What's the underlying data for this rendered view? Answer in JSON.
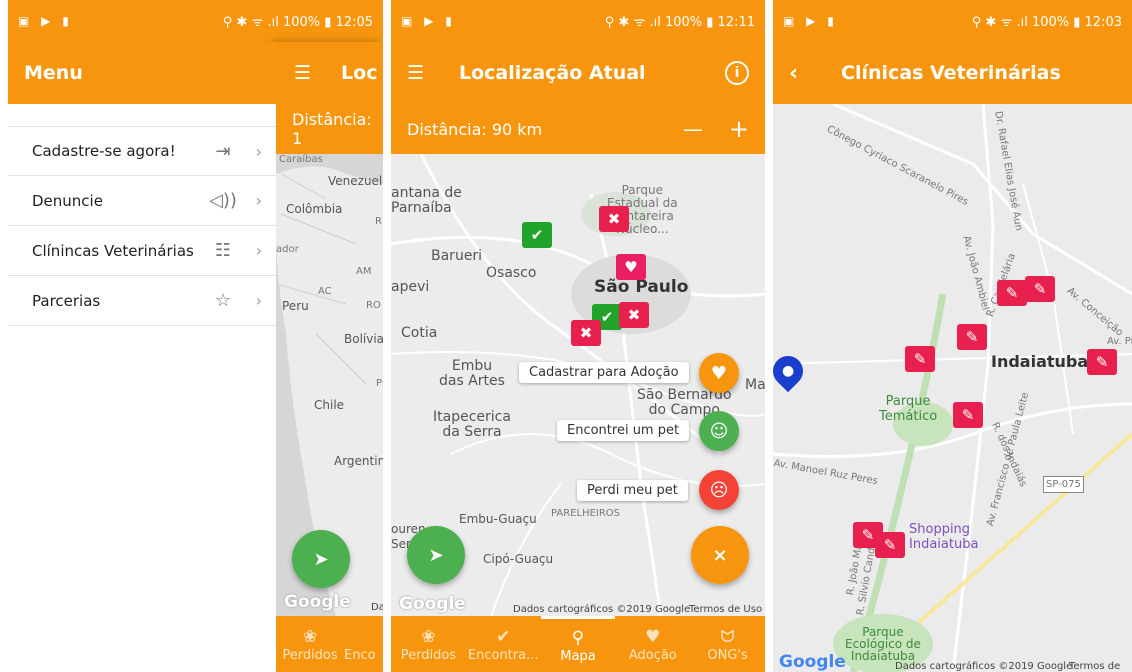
{
  "colors": {
    "primary": "#f7960e",
    "green": "#4caf50",
    "red": "#f44336",
    "pink": "#e91e63",
    "blue": "#1a3fcf"
  },
  "status": {
    "left_icons": "▣ ▶ ▮",
    "right_1": "⚲ ✱ ᯤ .ıl 100% ▮ 12:05",
    "right_2": "⚲ ✱ ᯤ .ıl 100% ▮ 12:11",
    "right_3": "⚲ ✱ ᯤ .ıl 100% ▮ 12:03"
  },
  "screen1": {
    "menu": {
      "title": "Menu",
      "items": [
        {
          "label": "Cadastre-se agora!",
          "icon": "login-icon"
        },
        {
          "label": "Denuncie",
          "icon": "speaker-icon"
        },
        {
          "label": "Clínincas Veterinárias",
          "icon": "list-icon"
        },
        {
          "label": "Parcerias",
          "icon": "star-icon"
        }
      ]
    },
    "behind": {
      "title": "Loc",
      "distance": "Distância: 1",
      "map_labels": {
        "caraibas": "Caraíbas",
        "venezuela": "Venezuela",
        "colombia": "Colômbia",
        "r": "R",
        "ador": "ador",
        "am": "AM",
        "ac": "AC",
        "peru": "Peru",
        "ro": "RO",
        "bolivia": "Bolívia",
        "p": "P",
        "chile": "Chile",
        "argentina": "Argentina",
        "google": "Google",
        "da": "Da"
      },
      "nav": [
        "Perdidos",
        "Enco"
      ]
    }
  },
  "screen2": {
    "title": "Localização Atual",
    "distance": "Distância: 90 km",
    "minus": "—",
    "plus": "+",
    "map_labels": {
      "santana": "antana de\nParnaíba",
      "parque": "Parque\nEstadual da\nCantareira\nNúcleo...",
      "barueri": "Barueri",
      "osasco": "Osasco",
      "sao_paulo": "São Paulo",
      "capevi": "apevi",
      "cotia": "Cotia",
      "embu": "Embu\ndas Artes",
      "ma": "Ma",
      "sao_bernardo": "São Bernardo\ndo Campo",
      "itapecerica": "Itapecerica\nda Serra",
      "embu_guacu": "Embu-Guaçu",
      "parelheiros": "PARELHEIROS",
      "louren": "ouren\nSer",
      "cipo": "Cipó-Guaçu",
      "google": "Google",
      "attribution": "Dados cartográficos ©2019 Google",
      "terms": "Termos de Uso"
    },
    "actions": [
      {
        "label": "Cadastrar para Adoção",
        "icon": "heart-icon"
      },
      {
        "label": "Encontrei um pet",
        "icon": "smile-icon"
      },
      {
        "label": "Perdi meu pet",
        "icon": "sad-icon"
      }
    ],
    "close_symbol": "×",
    "nav": [
      {
        "label": "Perdidos",
        "icon": "paw-icon"
      },
      {
        "label": "Encontra...",
        "icon": "check-icon"
      },
      {
        "label": "Mapa",
        "icon": "pin-icon"
      },
      {
        "label": "Adoção",
        "icon": "heart-icon"
      },
      {
        "label": "ONG's",
        "icon": "hands-icon"
      }
    ]
  },
  "screen3": {
    "title": "Clínicas Veterinárias",
    "map_labels": {
      "conego": "Cônego Cyriaco Scaranelo Pires",
      "elias": "Dr. Rafael Elias José Aun",
      "joao": "Av. João Ambiel",
      "candelaria": "R. Candelária",
      "conceicao": "Av. Conceição",
      "pr": "Av. Pr",
      "indaiatuba": "Indaiatuba",
      "parque_tematico": "Parque\nTemático",
      "paula_leite": "Av. Francisco de Paula Leite",
      "indaias": "R. dos Indaiás",
      "manoel": "Av. Manoel Ruz Peres",
      "sp075": "SP-075",
      "shopping": "Shopping\nIndaiatuba",
      "joao_martini": "R. João Martini",
      "silvio": "R. Silvio Candello",
      "parque_eco": "Parque\nEcológico de\nIndaiatuba",
      "google": "Google",
      "attribution": "Dados cartográficos ©2019 Google",
      "terms": "Termos de Us"
    }
  }
}
